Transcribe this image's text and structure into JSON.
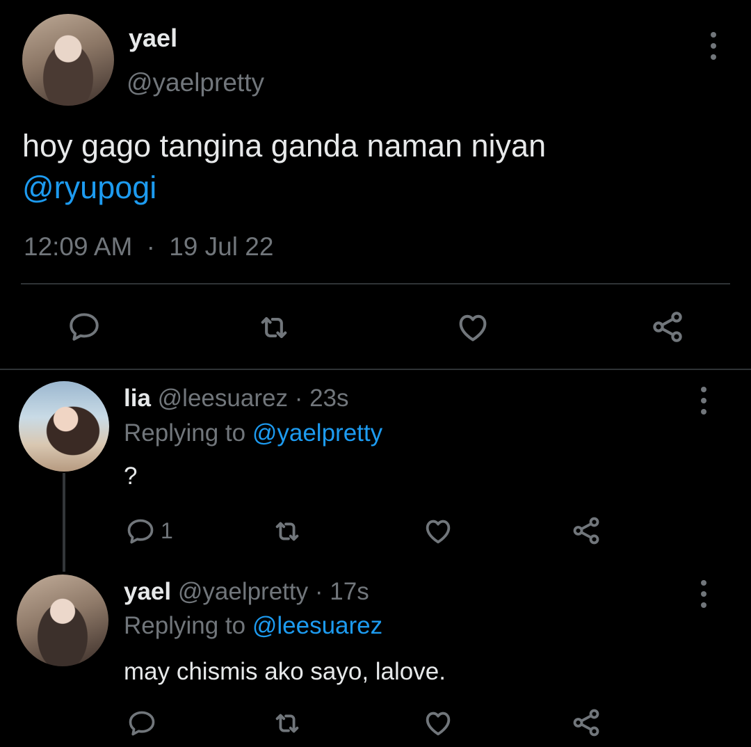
{
  "main_tweet": {
    "author_name": "yael",
    "author_handle": "@yaelpretty",
    "text_line1": "hoy gago tangina ganda naman niyan",
    "mention": "@ryupogi",
    "time": "12:09 AM",
    "separator": "·",
    "date": "19 Jul 22"
  },
  "replies": [
    {
      "author_name": "lia",
      "author_handle": "@leesuarez",
      "separator": "·",
      "age": "23s",
      "replying_label": "Replying to",
      "replying_handle": "@yaelpretty",
      "text": "?",
      "reply_count": "1"
    },
    {
      "author_name": "yael",
      "author_handle": "@yaelpretty",
      "separator": "·",
      "age": "17s",
      "replying_label": "Replying to",
      "replying_handle": "@leesuarez",
      "text": "may chismis ako sayo, lalove."
    }
  ],
  "colors": {
    "background": "#000000",
    "primary_text": "#e7e9ea",
    "secondary_text": "#71767b",
    "link": "#1d9bf0",
    "divider": "#2f3336"
  },
  "icons": [
    "reply-icon",
    "retweet-icon",
    "like-icon",
    "share-icon",
    "more-icon"
  ]
}
